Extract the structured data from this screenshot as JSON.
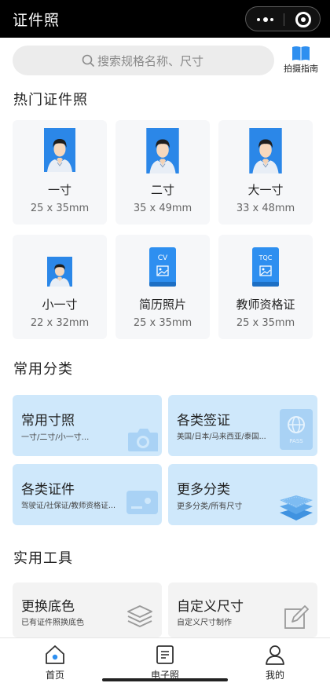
{
  "app": {
    "title": "证件照"
  },
  "search": {
    "placeholder": "搜索规格名称、尺寸",
    "guide_label": "拍摄指南"
  },
  "hot": {
    "title": "热门证件照",
    "items": [
      {
        "name": "一寸",
        "size": "25 x 35mm",
        "icon": "portrait-photo-icon"
      },
      {
        "name": "二寸",
        "size": "35 x 49mm",
        "icon": "portrait-photo-icon"
      },
      {
        "name": "大一寸",
        "size": "33 x 48mm",
        "icon": "portrait-photo-icon"
      },
      {
        "name": "小一寸",
        "size": "22 x 32mm",
        "icon": "portrait-photo-icon"
      },
      {
        "name": "简历照片",
        "size": "25 x 35mm",
        "icon": "cv-document-icon",
        "badge": "CV"
      },
      {
        "name": "教师资格证",
        "size": "25 x 35mm",
        "icon": "tqc-document-icon",
        "badge": "TQC"
      }
    ]
  },
  "categories": {
    "title": "常用分类",
    "items": [
      {
        "title": "常用寸照",
        "sub": "一寸/二寸/小一寸...",
        "icon": "camera-icon"
      },
      {
        "title": "各类签证",
        "sub": "美国/日本/马来西亚/泰国...",
        "icon": "passport-icon",
        "badge": "PASS"
      },
      {
        "title": "各类证件",
        "sub": "驾驶证/社保证/教师资格证...",
        "icon": "id-card-icon"
      },
      {
        "title": "更多分类",
        "sub": "更多分类/所有尺寸",
        "icon": "layers-icon"
      }
    ]
  },
  "tools": {
    "title": "实用工具",
    "items": [
      {
        "title": "更换底色",
        "sub": "已有证件照换底色",
        "icon": "layers-outline-icon"
      },
      {
        "title": "自定义尺寸",
        "sub": "自定义尺寸制作",
        "icon": "edit-icon"
      }
    ]
  },
  "tabbar": {
    "items": [
      {
        "label": "首页",
        "icon": "home-icon",
        "active": true
      },
      {
        "label": "电子照",
        "icon": "document-icon",
        "active": false
      },
      {
        "label": "我的",
        "icon": "user-icon",
        "active": false
      }
    ]
  },
  "colors": {
    "accent": "#2e8ff0",
    "card_bg": "#f6f7f9",
    "category_bg": "#cfe8fb",
    "photo_bg": "#2b87e8"
  }
}
